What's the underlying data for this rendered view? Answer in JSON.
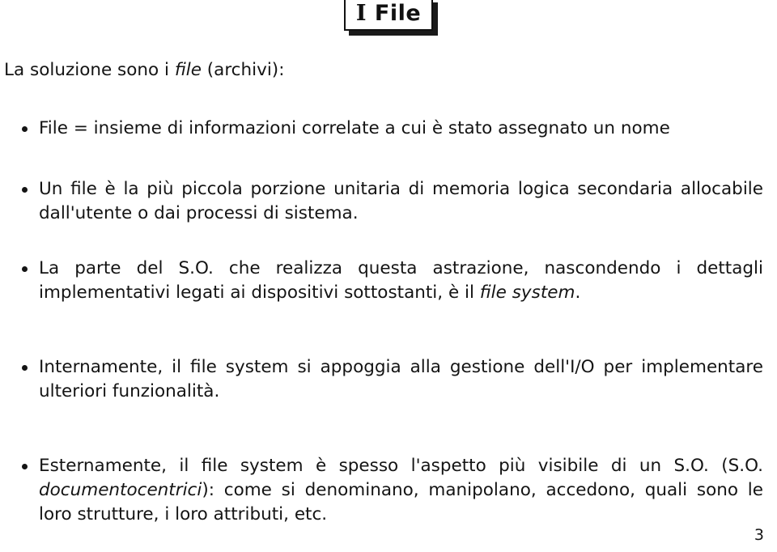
{
  "slide": {
    "title": "I File",
    "title_first_letter": "I",
    "title_rest": " File",
    "page_number": "3",
    "background_color": "#ffffff",
    "text_color": "#141414",
    "lead": "La soluzione sono i file (archivi):",
    "lead_parts": {
      "before": "La soluzione sono i ",
      "italic": "file",
      "after": " (archivi):"
    },
    "bullets": [
      {
        "id": "bullet-file-definition",
        "text": "File = insieme di informazioni correlate a cui è stato assegnato un nome",
        "parts": [
          {
            "style": "normal",
            "text": "File "
          },
          {
            "style": "normal",
            "text": "= "
          },
          {
            "style": "normal",
            "text": "insieme di informazioni correlate a cui è stato assegnato un nome"
          }
        ]
      },
      {
        "id": "bullet-file-smallest-unit",
        "text": "Un file è la più piccola porzione unitaria di memoria logica secondaria allocabile dall'utente o dai processi di sistema.",
        "parts": [
          {
            "style": "normal",
            "text": "Un file è la più piccola porzione unitaria di memoria logica secondaria allocabile dall'utente o dai processi di sistema."
          }
        ]
      },
      {
        "id": "bullet-os-filesystem",
        "text": "La parte del S.O. che realizza questa astrazione, nascondendo i dettagli implementativi legati ai dispositivi sottostanti, è il file system.",
        "parts": [
          {
            "style": "normal",
            "text": "La parte del S.O. che realizza questa astrazione, nascondendo i dettagli implementativi legati ai dispositivi sottostanti, è il "
          },
          {
            "style": "italic",
            "text": "file system"
          },
          {
            "style": "normal",
            "text": "."
          }
        ]
      },
      {
        "id": "bullet-internally-io",
        "text": "Internamente, il file system si appoggia alla gestione dell'I/O per implementare ulteriori funzionalità.",
        "parts": [
          {
            "style": "normal",
            "text": "Internamente, il file system si appoggia alla gestione dell'I/O per implementare ulteriori funzionalità."
          }
        ]
      },
      {
        "id": "bullet-externally-visible",
        "text": "Esternamente, il file system è spesso l'aspetto più visibile di un S.O. (S.O. documentocentrici): come si denominano, manipolano, accedono, quali sono le loro strutture, i loro attributi, etc.",
        "parts": [
          {
            "style": "normal",
            "text": "Esternamente, il file system è spesso l'aspetto più visibile di un S.O. (S.O. "
          },
          {
            "style": "italic",
            "text": "documentocentrici"
          },
          {
            "style": "normal",
            "text": "): come si denominano, manipolano, accedono, quali sono le loro strutture, i loro attributi, etc."
          }
        ]
      }
    ]
  }
}
